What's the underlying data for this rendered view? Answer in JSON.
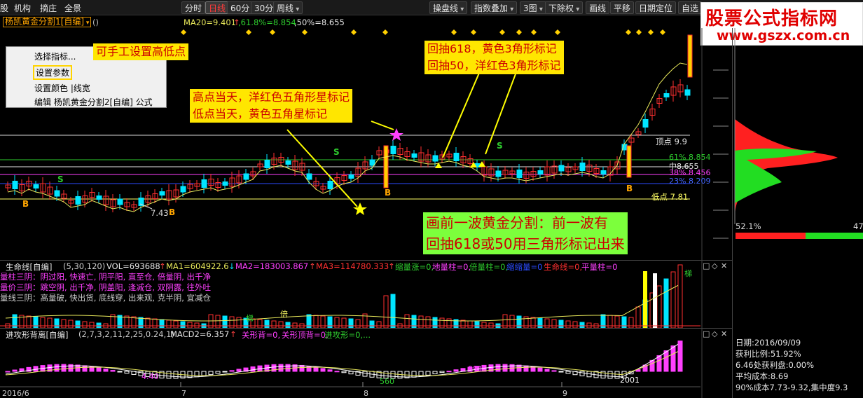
{
  "topbar": {
    "menu": [
      "股",
      "机构",
      "摘庄",
      "全景"
    ],
    "period_buttons": [
      "分时",
      "日线",
      "60分",
      "30分",
      "周线"
    ],
    "active_period": "日线",
    "right_buttons": [
      "操盘线",
      "指数叠加",
      "3图",
      "下除权",
      "画线",
      "平移",
      "日期定位",
      "自选"
    ]
  },
  "logo": {
    "line1": "股票公式指标网",
    "line2": "www.gszx.com.cn"
  },
  "formula_header": {
    "name": "杨凯黄金分割1[自编]",
    "suffix": "()",
    "ma20": "MA20=9.401",
    "r618": ",61.8%=8.854",
    "r50": ",50%=8.655"
  },
  "popup_menu": {
    "items": [
      "选择指标...",
      "设置参数",
      "设置颜色 |线宽",
      "编辑  杨凯黄金分割2[自编]  公式"
    ],
    "selected": "设置参数"
  },
  "annotations": {
    "manual": "可手工设置高低点",
    "pullback_line1": "回抽618，黄色3角形标记",
    "pullback_line2": "回抽50，洋红色3角形标记",
    "star_line1": "高点当天，洋红色五角形星标记",
    "star_line2": "低点当天，黄色五角星标记",
    "summary_line1": "画前一波黄金分割：前一波有",
    "summary_line2": "回抽618或50用三角形标记出来"
  },
  "price_labels": {
    "top": "顶点  9.9",
    "r618": "61%  8.854",
    "mid": "中8.655",
    "r38": "38%  8.456",
    "r23": "23%  8.209",
    "low": "低点  7.81",
    "min": "7.43"
  },
  "chart_data": {
    "type": "candlestick",
    "x_ticks": [
      "2016/6",
      "7",
      "8",
      "9"
    ],
    "levels": {
      "top": 9.9,
      "r618": 8.854,
      "mid": 8.655,
      "r38": 8.456,
      "r23": 8.209,
      "low": 7.81,
      "min": 7.43
    },
    "signals": [
      "B",
      "S"
    ]
  },
  "volume_panel": {
    "title": "生命线[自编]",
    "params": "(5,30,120)",
    "vol": "VOL=693688",
    "ma1": "MA1=604922.6",
    "ma2": "MA2=183003.867",
    "ma3": "MA3=114780.333",
    "legend": [
      "缩量涨=0,",
      "地量柱=0,",
      "倍量柱=0,",
      "缩缩量=0",
      "生命线=0,",
      "平量柱=0"
    ],
    "left_text": [
      "量柱三阴：阴过阳, 快速亡, 阴平阳, 直至仓, 倍量阴, 出千净",
      "量价三阴：跳空阴, 出千净, 阴盖阳, 逢减仓, 双阴露, 往外吐",
      "量线三阴：高量破, 快出货, 底线穿, 出来观, 克半阴, 宜减仓"
    ],
    "marks": [
      "梯",
      "倍",
      "梯"
    ]
  },
  "macd_panel": {
    "title": "进攻形背离[自编]",
    "params": "(2,7,3,2,11,2,25,0.24,1)",
    "macd": "MACD2=6.357",
    "legend": [
      "关形背=0,",
      "关形顶背=0,",
      "进攻形=0,..."
    ],
    "labels": [
      "560",
      "991",
      "2001",
      "4.40"
    ]
  },
  "side_panel": {
    "pct_left": "52.1%",
    "pct_right": "47",
    "date": "日期:2016/09/09",
    "profit_ratio": "获利比例:51.92%",
    "profit_at": "6.46处获利盘:0.00%",
    "avg_cost": "平均成本:8.69",
    "cost90": "90%成本7.73-9.32,集中度9.3"
  },
  "colors": {
    "up": "#ff3030",
    "down": "#00e5ff",
    "ma": "#e8e85a",
    "magenta": "#ff40ff",
    "yellow": "#ffff00",
    "green_line": "#2ecc2e"
  }
}
